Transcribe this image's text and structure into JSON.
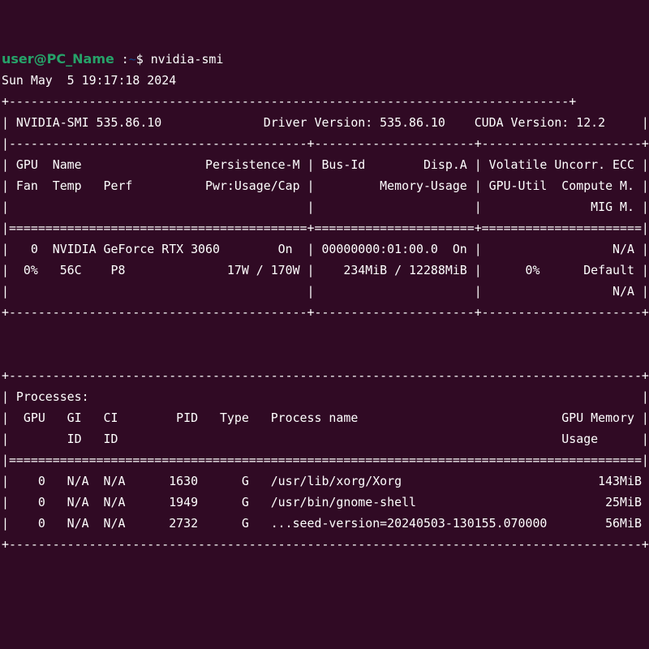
{
  "prompt": {
    "user_host": "user@PC_Name",
    "separator": " :",
    "path": "~",
    "dollar": "$ ",
    "command": "nvidia-smi"
  },
  "date_line": "Sun May  5 19:17:18 2024",
  "gpu_table": [
    "+-----------------------------------------------------------------------------+",
    "| NVIDIA-SMI 535.86.10              Driver Version: 535.86.10    CUDA Version: 12.2     |",
    "|-----------------------------------------+----------------------+----------------------+",
    "| GPU  Name                 Persistence-M | Bus-Id        Disp.A | Volatile Uncorr. ECC |",
    "| Fan  Temp   Perf          Pwr:Usage/Cap |         Memory-Usage | GPU-Util  Compute M. |",
    "|                                         |                      |               MIG M. |",
    "|=========================================+======================+======================|",
    "|   0  NVIDIA GeForce RTX 3060        On  | 00000000:01:00.0  On |                  N/A |",
    "|  0%   56C    P8              17W / 170W |    234MiB / 12288MiB |      0%      Default |",
    "|                                         |                      |                  N/A |",
    "+-----------------------------------------+----------------------+----------------------+"
  ],
  "blank_lines": [
    "",
    ""
  ],
  "process_table": [
    "+---------------------------------------------------------------------------------------+",
    "| Processes:                                                                            |",
    "|  GPU   GI   CI        PID   Type   Process name                            GPU Memory |",
    "|        ID   ID                                                             Usage      |",
    "|=======================================================================================|",
    "|    0   N/A  N/A      1630      G   /usr/lib/xorg/Xorg                           143MiB |",
    "|    0   N/A  N/A      1949      G   /usr/bin/gnome-shell                          25MiB |",
    "|    0   N/A  N/A      2732      G   ...seed-version=20240503-130155.070000        56MiB |",
    "+---------------------------------------------------------------------------------------+"
  ]
}
